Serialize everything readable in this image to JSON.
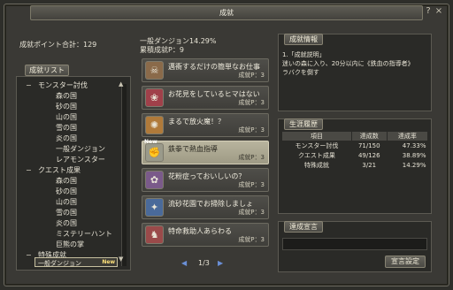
{
  "window": {
    "title": "成就"
  },
  "points": {
    "label": "成就ポイント合計：129"
  },
  "list_tab": {
    "label": "成就リスト"
  },
  "tree": [
    {
      "text": "モンスター討伐",
      "level": "cat"
    },
    {
      "text": "森の国",
      "level": "sub"
    },
    {
      "text": "砂の国",
      "level": "sub"
    },
    {
      "text": "山の国",
      "level": "sub"
    },
    {
      "text": "雪の国",
      "level": "sub"
    },
    {
      "text": "炎の国",
      "level": "sub"
    },
    {
      "text": "一般ダンジョン",
      "level": "sub"
    },
    {
      "text": "レアモンスター",
      "level": "sub"
    },
    {
      "text": "クエスト成果",
      "level": "cat"
    },
    {
      "text": "森の国",
      "level": "sub"
    },
    {
      "text": "砂の国",
      "level": "sub"
    },
    {
      "text": "山の国",
      "level": "sub"
    },
    {
      "text": "雪の国",
      "level": "sub"
    },
    {
      "text": "炎の国",
      "level": "sub"
    },
    {
      "text": "ミステリーハント",
      "level": "sub"
    },
    {
      "text": "巨熊の掌",
      "level": "sub"
    },
    {
      "text": "特殊成就",
      "level": "cat"
    }
  ],
  "tree_selected": {
    "text": "一般ダンジョン",
    "badge": "New"
  },
  "category_header": {
    "line1": "一般ダンジョン14.29%",
    "line2": "累積成就P：9"
  },
  "achievements": [
    {
      "name": "邁衝するだけの簡単なお仕事",
      "pts": "成就P：3",
      "icon": "skull-icon",
      "glyph": "☠",
      "color": "#8a6a4a"
    },
    {
      "name": "お花見をしているヒマはない",
      "pts": "成就P：3",
      "icon": "demon-icon",
      "glyph": "❀",
      "color": "#a0404a"
    },
    {
      "name": "まるで放火魔！？",
      "pts": "成就P：3",
      "icon": "fire-orb-icon",
      "glyph": "✺",
      "color": "#b07a3a"
    },
    {
      "name": "鉄拳で熱血指導",
      "pts": "成就P：3",
      "icon": "fist-icon",
      "glyph": "✊",
      "color": "#9a9a8a",
      "new": "New"
    },
    {
      "name": "花粉症っておいしいの？",
      "pts": "成就P：3",
      "icon": "flower-icon",
      "glyph": "✿",
      "color": "#7a5a8a"
    },
    {
      "name": "流砂花園でお掃除しましょ",
      "pts": "成就P：3",
      "icon": "sand-icon",
      "glyph": "✦",
      "color": "#4a6a9a"
    },
    {
      "name": "特命救助人あらわる",
      "pts": "成就P：3",
      "icon": "rescue-icon",
      "glyph": "♞",
      "color": "#9a4a4a"
    }
  ],
  "pager": {
    "text": "1/3",
    "prev": "◀",
    "next": "▶"
  },
  "info": {
    "tab": "成就情報",
    "title": "1.「成就説明」",
    "desc1": "迷いの森に入り、20分以内に《鉄血の指導者》",
    "desc2": "ラバクを倒す"
  },
  "history": {
    "tab": "生涯履歴",
    "headers": [
      "項目",
      "達成数",
      "達成率"
    ],
    "rows": [
      [
        "モンスター討伐",
        "71/150",
        "47.33%"
      ],
      [
        "クエスト成果",
        "49/126",
        "38.89%"
      ],
      [
        "特殊成就",
        "3/21",
        "14.29%"
      ]
    ]
  },
  "declare": {
    "tab": "達成宣言",
    "button": "宣言設定"
  },
  "icons": {
    "close": "×",
    "help": "?",
    "scroll_up": "▲",
    "scroll_down": "▼"
  }
}
